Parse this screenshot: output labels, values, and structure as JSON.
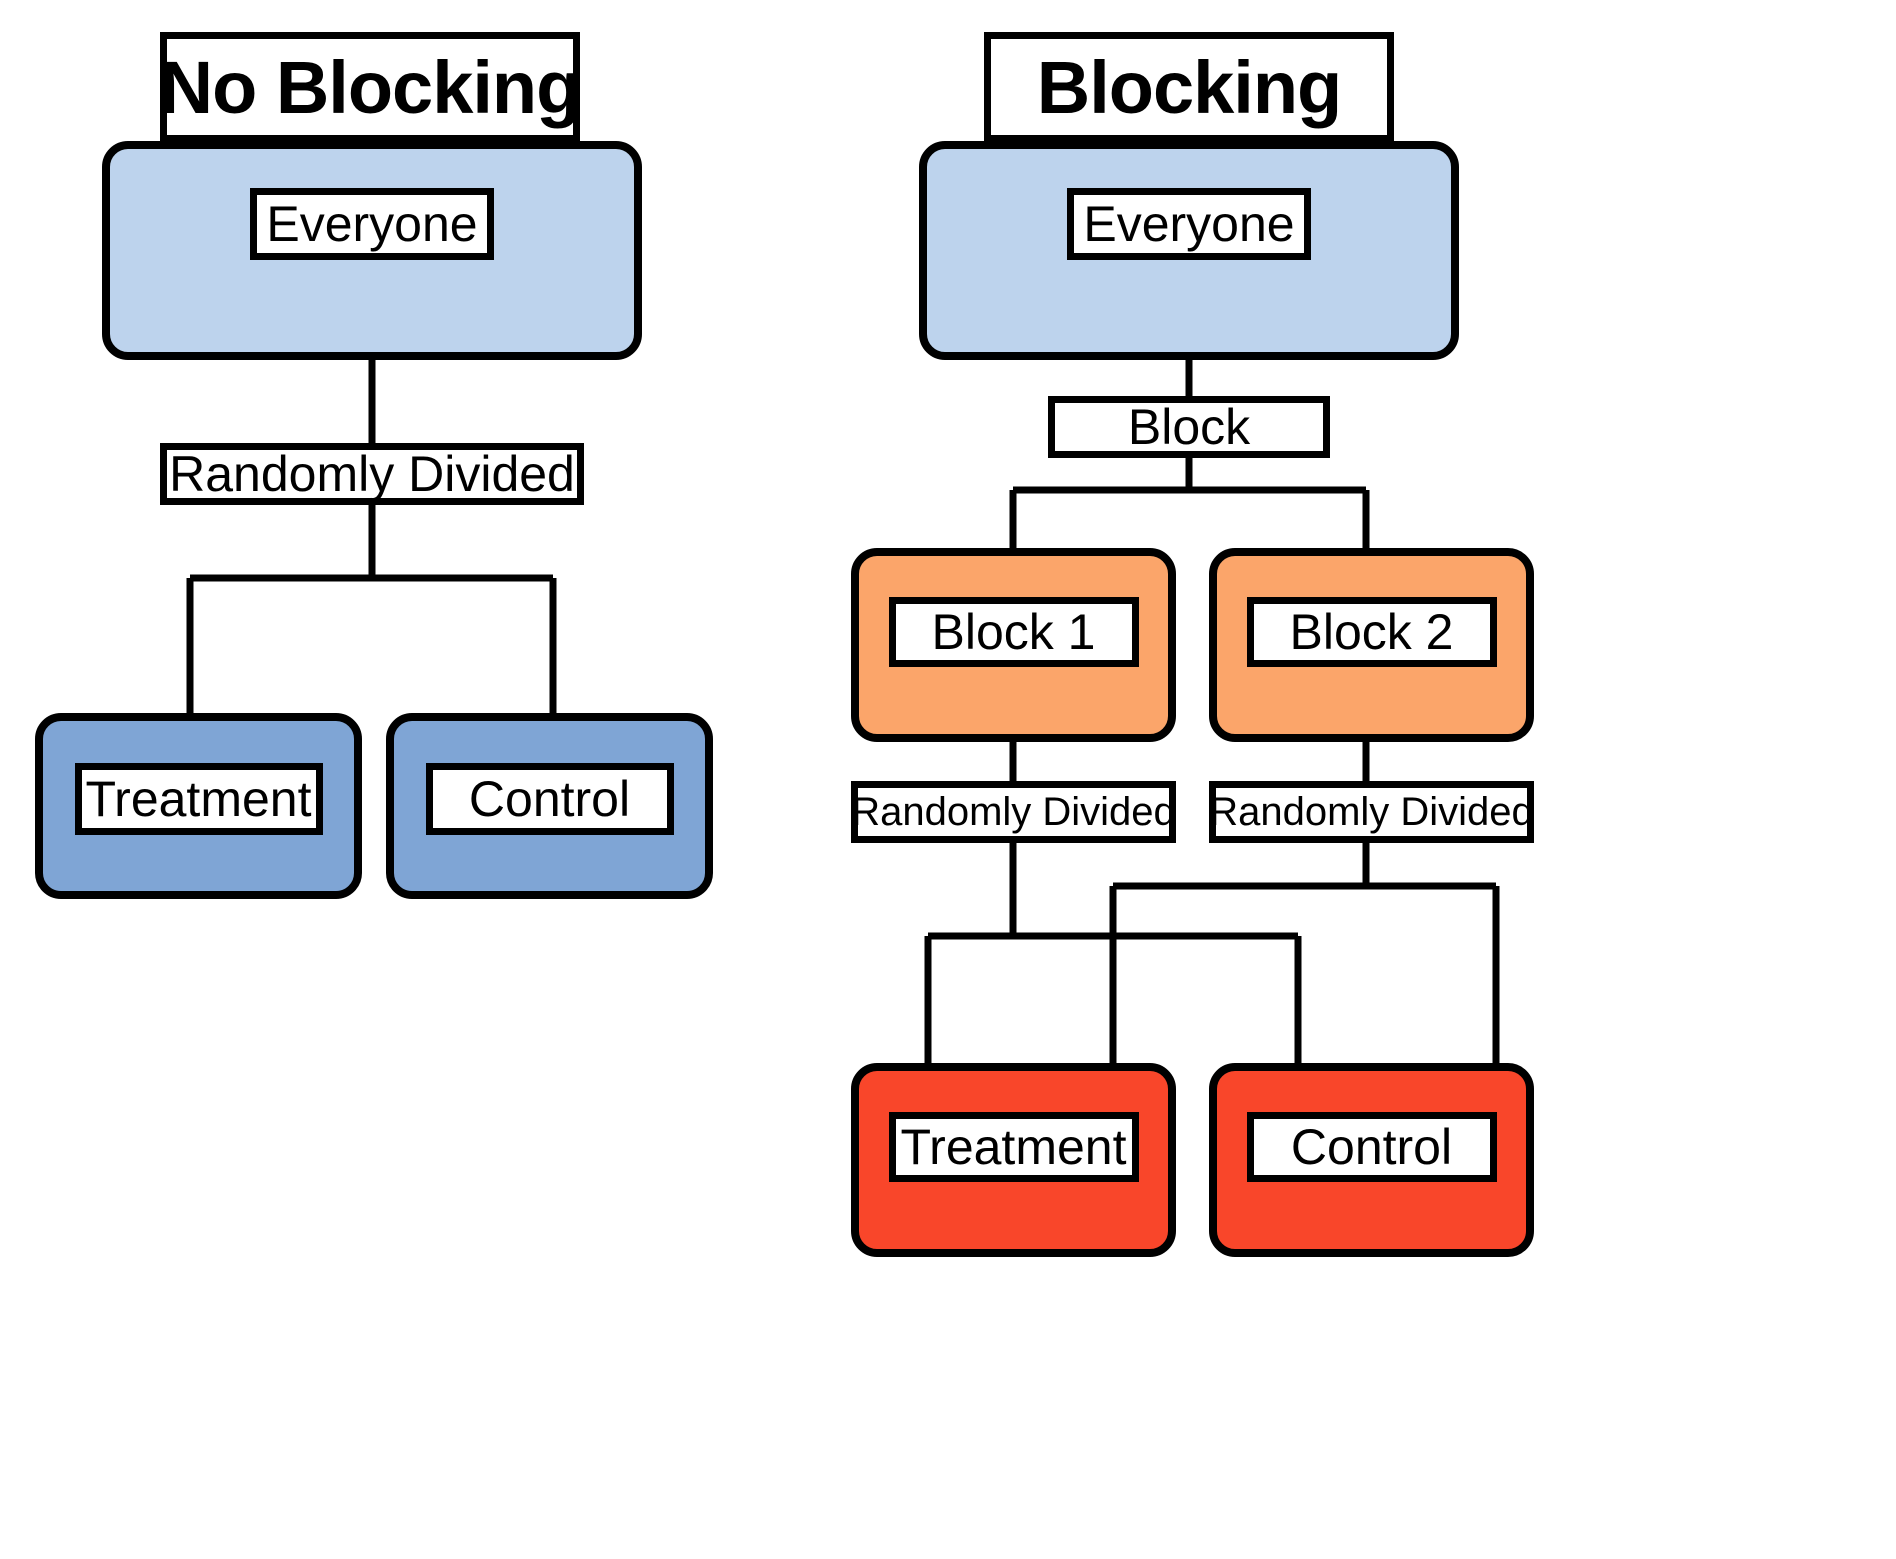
{
  "figure": {
    "panels": [
      {
        "id": "no-blocking",
        "title": "No Blocking",
        "nodes": {
          "everyone": "Everyone",
          "randomly_divided": "Randomly Divided",
          "treatment": "Treatment",
          "control": "Control"
        }
      },
      {
        "id": "blocking",
        "title": "Blocking",
        "nodes": {
          "everyone": "Everyone",
          "block": "Block",
          "block1": "Block 1",
          "block2": "Block 2",
          "randomly_divided_1": "Randomly Divided",
          "randomly_divided_2": "Randomly Divided",
          "treatment": "Treatment",
          "control": "Control"
        }
      }
    ],
    "colors": {
      "population": "#bdd3ed",
      "assignment_left": "#7fa5d5",
      "block": "#fba56a",
      "assignment_right": "#f9462a",
      "outline": "#000000",
      "background": "#ffffff"
    }
  }
}
